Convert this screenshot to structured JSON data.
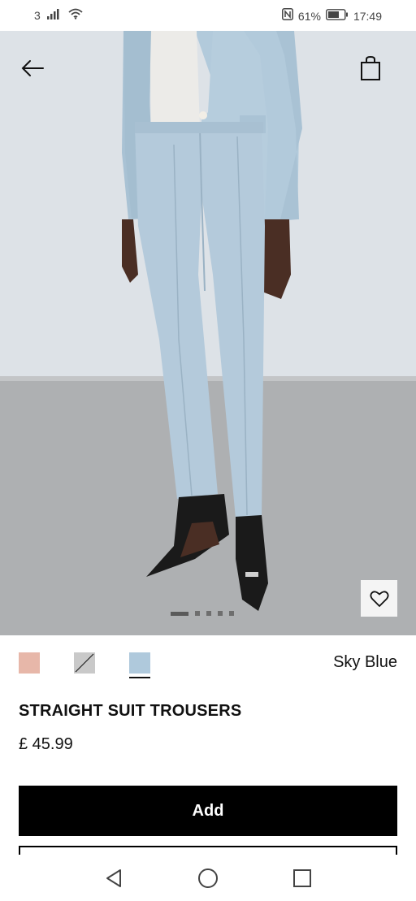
{
  "status_bar": {
    "sim_label": "3",
    "battery_percent": "61%",
    "time": "17:49",
    "icons": [
      "signal-icon",
      "wifi-icon",
      "nfc-icon",
      "battery-icon"
    ]
  },
  "hero": {
    "back_icon": "arrow-left-icon",
    "bag_icon": "shopping-bag-icon",
    "favourite_icon": "heart-icon",
    "carousel": {
      "total": 5,
      "active_index": 0
    }
  },
  "product": {
    "colors": [
      {
        "name": "pink",
        "hex": "#e7b7a9",
        "available": true
      },
      {
        "name": "grey",
        "hex": "#c9c9c9",
        "available": false
      },
      {
        "name": "sky-blue",
        "hex": "#afc9dc",
        "available": true,
        "selected": true
      }
    ],
    "selected_color_name": "Sky Blue",
    "title": "STRAIGHT SUIT TROUSERS",
    "price": "£ 45.99",
    "add_label": "Add"
  },
  "nav_bar": {
    "icons": [
      "back-triangle-icon",
      "home-circle-icon",
      "recents-square-icon"
    ]
  }
}
